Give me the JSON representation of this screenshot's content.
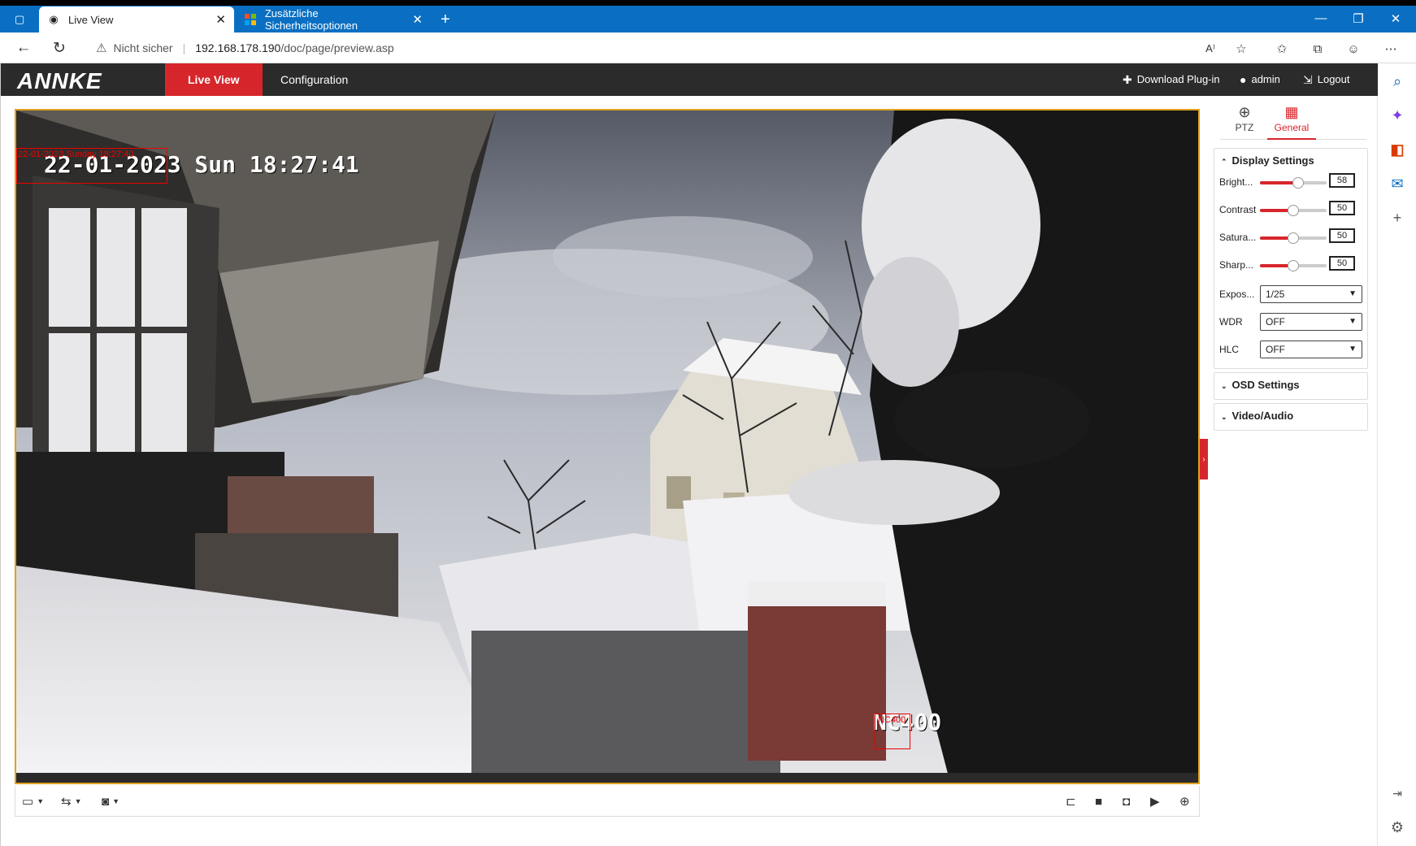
{
  "browser": {
    "tabs": [
      {
        "title": "Live View",
        "icon": "camera-favicon"
      },
      {
        "title": "Zusätzliche Sicherheitsoptionen",
        "icon": "microsoft-favicon"
      }
    ],
    "new_tab_symbol": "+",
    "security_label": "Nicht sicher",
    "url_host": "192.168.178.190",
    "url_path": "/doc/page/preview.asp",
    "window_controls": [
      "—",
      "❐",
      "✕"
    ]
  },
  "app": {
    "logo": "ANNKE",
    "nav": [
      {
        "label": "Live View",
        "active": true
      },
      {
        "label": "Configuration",
        "active": false
      }
    ],
    "download_plugin": "Download Plug-in",
    "user": "admin",
    "logout": "Logout"
  },
  "video": {
    "osd_datetime": "22-01-2023 Sun 18:27:41",
    "osd_datetime_red": "22-01-2023 Sunday 18:27:40",
    "osd_camera_name": "NC400",
    "osd_camera_name_red": "NC400"
  },
  "side": {
    "tabs": [
      {
        "label": "PTZ",
        "active": false
      },
      {
        "label": "General",
        "active": true
      }
    ],
    "display_settings": {
      "title": "Display Settings",
      "sliders": [
        {
          "label": "Bright...",
          "value": "58"
        },
        {
          "label": "Contrast",
          "value": "50"
        },
        {
          "label": "Satura...",
          "value": "50"
        },
        {
          "label": "Sharp...",
          "value": "50"
        }
      ],
      "selects": [
        {
          "label": "Expos...",
          "value": "1/25"
        },
        {
          "label": "WDR",
          "value": "OFF"
        },
        {
          "label": "HLC",
          "value": "OFF"
        }
      ]
    },
    "osd_settings": {
      "title": "OSD Settings"
    },
    "video_audio": {
      "title": "Video/Audio"
    }
  },
  "colors": {
    "accent": "#d7262b",
    "topbar": "#2b2b2b",
    "browser_blue": "#0a6fc2"
  }
}
